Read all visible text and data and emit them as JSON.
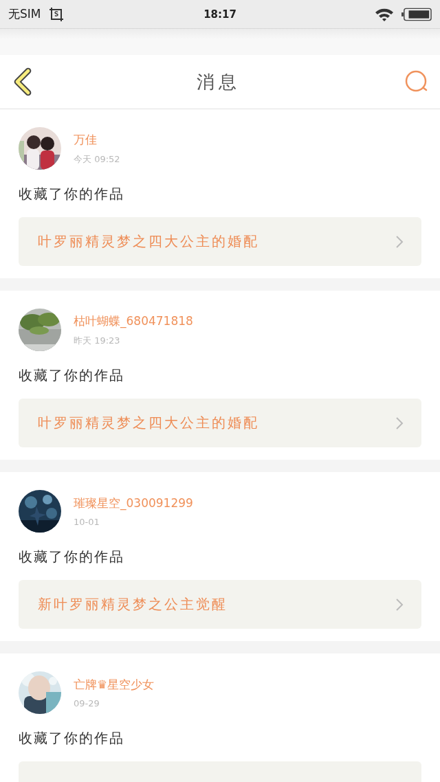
{
  "status_bar": {
    "carrier": "无SIM",
    "time": "18:17"
  },
  "header": {
    "title": "消息"
  },
  "messages": [
    {
      "user": "万佳",
      "time": "今天 09:52",
      "action": "收藏了你的作品",
      "work": "叶罗丽精灵梦之四大公主的婚配"
    },
    {
      "user": "枯叶蝴蝶_680471818",
      "time": "昨天 19:23",
      "action": "收藏了你的作品",
      "work": "叶罗丽精灵梦之四大公主的婚配"
    },
    {
      "user": "璀璨星空_030091299",
      "time": "10-01",
      "action": "收藏了你的作品",
      "work": "新叶罗丽精灵梦之公主觉醒"
    },
    {
      "user": "亡牌♛星空少女",
      "time": "09-29",
      "action": "收藏了你的作品"
    }
  ]
}
